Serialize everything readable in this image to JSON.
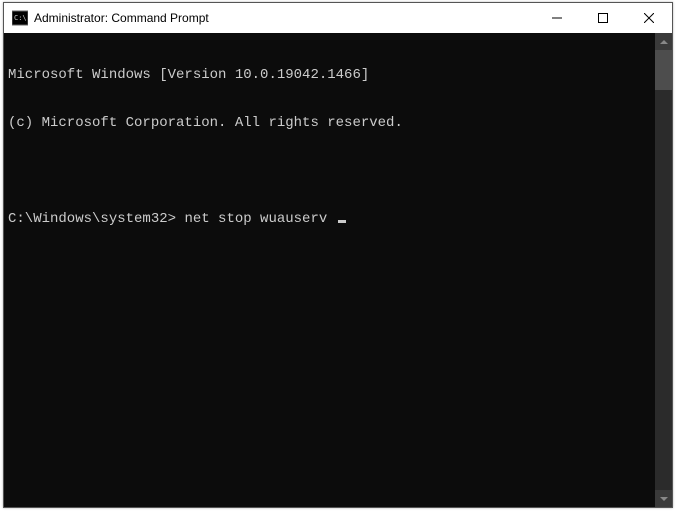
{
  "window": {
    "title": "Administrator: Command Prompt"
  },
  "terminal": {
    "line1": "Microsoft Windows [Version 10.0.19042.1466]",
    "line2": "(c) Microsoft Corporation. All rights reserved.",
    "blank": "",
    "prompt_path": "C:\\Windows\\system32>",
    "command": "net stop wuauserv"
  }
}
